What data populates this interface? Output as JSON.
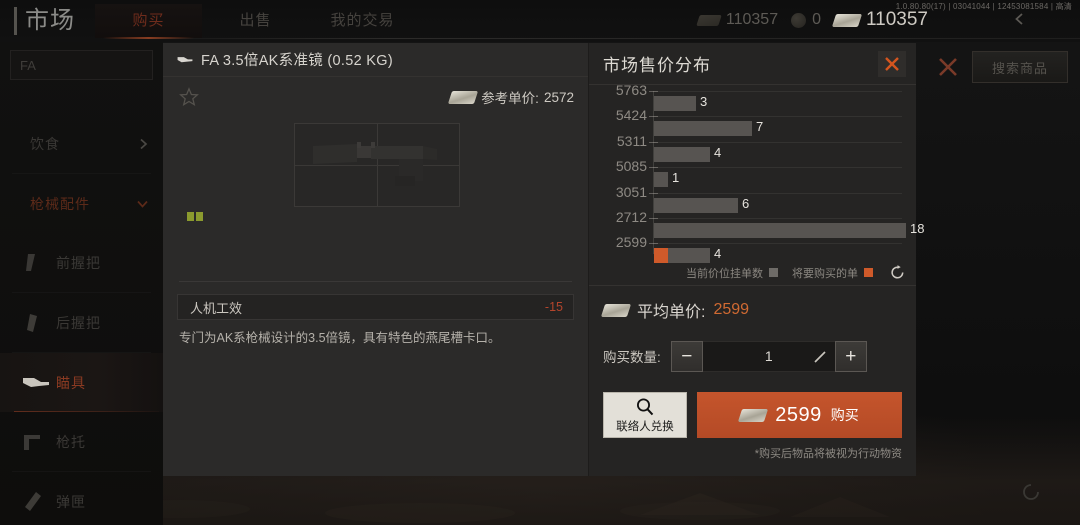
{
  "topbar": {
    "market_label": "市场",
    "tabs": [
      {
        "label": "购买",
        "active": true
      },
      {
        "label": "出售",
        "active": false
      },
      {
        "label": "我的交易",
        "active": false
      }
    ],
    "currencies": [
      {
        "icon": "cash-icon",
        "value": "110357",
        "bright": false
      },
      {
        "icon": "coin-icon",
        "value": "0",
        "bright": false
      },
      {
        "icon": "cash-icon",
        "value": "110357",
        "bright": true
      }
    ],
    "version_info": "1.0.80.80(17) | 03041044 | 12453081584 | 高清",
    "back_icon": "chevron-left-icon",
    "search_button": "搜索商品",
    "close_icon": "close-icon"
  },
  "sidebar": {
    "search_value": "FA",
    "search_placeholder": "FA",
    "items": [
      {
        "label": "饮食",
        "icon": "food-icon",
        "state": "collapsed",
        "chevron": "chevron-right-icon"
      },
      {
        "label": "枪械配件",
        "icon": "attachment-icon",
        "state": "category-open",
        "chevron": "chevron-down-icon"
      },
      {
        "label": "前握把",
        "icon": "foregrip-icon",
        "state": "normal"
      },
      {
        "label": "后握把",
        "icon": "grip-icon",
        "state": "normal"
      },
      {
        "label": "瞄具",
        "icon": "scope-icon",
        "state": "active"
      },
      {
        "label": "枪托",
        "icon": "stock-icon",
        "state": "normal"
      },
      {
        "label": "弹匣",
        "icon": "magazine-icon",
        "state": "normal"
      }
    ]
  },
  "detail": {
    "icon": "scope-icon",
    "title": "FA 3.5倍AK系准镜 (0.52 KG)",
    "favorite_icon": "star-icon",
    "ref_price_label": "参考单价:",
    "ref_price_value": "2572",
    "durability_blocks": 2,
    "stat": {
      "name": "人机工效",
      "value": "-15",
      "color": "#b4452c"
    },
    "description": "专门为AK系枪械设计的3.5倍镜，具有特色的燕尾槽卡口。"
  },
  "chart_data": {
    "type": "bar",
    "title": "市场售价分布",
    "orientation": "horizontal",
    "xlabel": "",
    "ylabel": "",
    "grid": true,
    "categories": [
      "5763",
      "5424",
      "5311",
      "5085",
      "3051",
      "2712",
      "2599"
    ],
    "values": [
      3,
      7,
      4,
      1,
      6,
      18,
      4
    ],
    "pending_values": [
      0,
      0,
      0,
      0,
      0,
      0,
      1
    ],
    "xlim": [
      0,
      18
    ],
    "legend_position": "bottom-right",
    "legend": [
      {
        "label": "当前价位挂单数",
        "color": "#6e6b67"
      },
      {
        "label": "将要购买的单",
        "color": "#cf5a2a"
      }
    ],
    "bar_color": "#575451",
    "pending_color": "#cf5a2a"
  },
  "purchase": {
    "close_icon": "close-icon",
    "refresh_icon": "refresh-icon",
    "avg_label": "平均单价:",
    "avg_value": "2599",
    "qty_label": "购买数量:",
    "qty_value": "1",
    "qty_minus": "−",
    "qty_plus": "+",
    "edit_icon": "pencil-icon",
    "contact_button": "联络人兑换",
    "contact_icon": "search-icon",
    "buy_price": "2599",
    "buy_word": "购买",
    "note": "*购买后物品将被视为行动物资"
  },
  "overlay": {
    "spinner_icon": "refresh-icon"
  },
  "colors": {
    "accent_orange": "#cf5a2a",
    "buy_button": "#c5552c",
    "panel_bg": "#2b2a29",
    "right_panel_bg": "#252423",
    "negative_stat": "#b4452c",
    "durability_green": "#8b9a2e"
  }
}
